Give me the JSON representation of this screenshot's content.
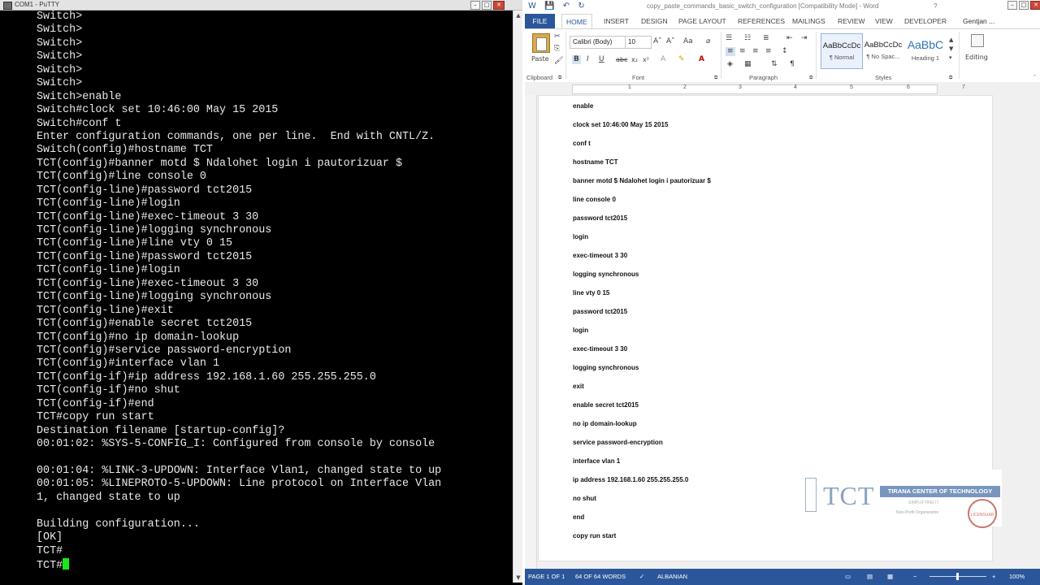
{
  "putty": {
    "title": "COM1 - PuTTY",
    "terminal_lines": [
      "Switch>",
      "Switch>",
      "Switch>",
      "Switch>",
      "Switch>",
      "Switch>",
      "Switch>enable",
      "Switch#clock set 10:46:00 May 15 2015",
      "Switch#conf t",
      "Enter configuration commands, one per line.  End with CNTL/Z.",
      "Switch(config)#hostname TCT",
      "TCT(config)#banner motd $ Ndalohet login i pautorizuar $",
      "TCT(config)#line console 0",
      "TCT(config-line)#password tct2015",
      "TCT(config-line)#login",
      "TCT(config-line)#exec-timeout 3 30",
      "TCT(config-line)#logging synchronous",
      "TCT(config-line)#line vty 0 15",
      "TCT(config-line)#password tct2015",
      "TCT(config-line)#login",
      "TCT(config-line)#exec-timeout 3 30",
      "TCT(config-line)#logging synchronous",
      "TCT(config-line)#exit",
      "TCT(config)#enable secret tct2015",
      "TCT(config)#no ip domain-lookup",
      "TCT(config)#service password-encryption",
      "TCT(config)#interface vlan 1",
      "TCT(config-if)#ip address 192.168.1.60 255.255.255.0",
      "TCT(config-if)#no shut",
      "TCT(config-if)#end",
      "TCT#copy run start",
      "Destination filename [startup-config]?",
      "00:01:02: %SYS-5-CONFIG_I: Configured from console by console",
      "",
      "00:01:04: %LINK-3-UPDOWN: Interface Vlan1, changed state to up",
      "00:01:05: %LINEPROTO-5-UPDOWN: Line protocol on Interface Vlan",
      "1, changed state to up",
      "",
      "Building configuration...",
      "[OK]",
      "TCT#"
    ],
    "prompt": "TCT#",
    "cursor_color": "#19e619"
  },
  "word": {
    "title": "copy_paste_commands_basic_switch_configuration [Compatibility Mode] - Word",
    "help": "?",
    "qat_icons": [
      "save-icon",
      "undo-icon",
      "redo-icon"
    ],
    "tabs": [
      "FILE",
      "HOME",
      "INSERT",
      "DESIGN",
      "PAGE LAYOUT",
      "REFERENCES",
      "MAILINGS",
      "REVIEW",
      "VIEW",
      "DEVELOPER"
    ],
    "user": "Gentjan ...",
    "ribbon": {
      "paste_label": "Paste",
      "font_name": "Calibri (Body)",
      "font_size": "10",
      "group_clipboard": "Clipboard",
      "group_font": "Font",
      "group_paragraph": "Paragraph",
      "group_styles": "Styles",
      "styles": [
        {
          "sample": "AaBbCcDc",
          "name": "¶ Normal"
        },
        {
          "sample": "AaBbCcDc",
          "name": "¶ No Spac..."
        },
        {
          "sample": "AaBbC",
          "name": "Heading 1"
        }
      ],
      "editing_label": "Editing"
    },
    "ruler_numbers": [
      "1",
      "2",
      "3",
      "4",
      "5",
      "6",
      "7"
    ],
    "document_lines": [
      "enable",
      "clock set 10:46:00 May 15 2015",
      "conf t",
      "hostname TCT",
      "banner motd $ Ndalohet login i pautorizuar $",
      "line console 0",
      "password tct2015",
      "login",
      "exec-timeout 3 30",
      "logging synchronous",
      "line vty 0 15",
      "password tct2015",
      "login",
      "exec-timeout 3 30",
      "logging synchronous",
      "exit",
      "enable secret tct2015",
      "no ip domain-lookup",
      "service password-encryption",
      "interface vlan 1",
      "ip address 192.168.1.60 255.255.255.0",
      "no shut",
      "end",
      "copy run start"
    ],
    "logo": {
      "mark": "TCT",
      "name": "TIRANA CENTER OF TECHNOLOGY",
      "tagline": "SIMPLIFYING IT",
      "org": "Non-Profit Organization",
      "seal": "LICENSUAR"
    },
    "status": {
      "page": "PAGE 1 OF 1",
      "words": "64 OF 64 WORDS",
      "language": "ALBANIAN",
      "zoom": "100%"
    }
  },
  "colors": {
    "word_blue": "#2b579a",
    "terminal_bg": "#000000",
    "terminal_fg": "#e8e8e8"
  }
}
